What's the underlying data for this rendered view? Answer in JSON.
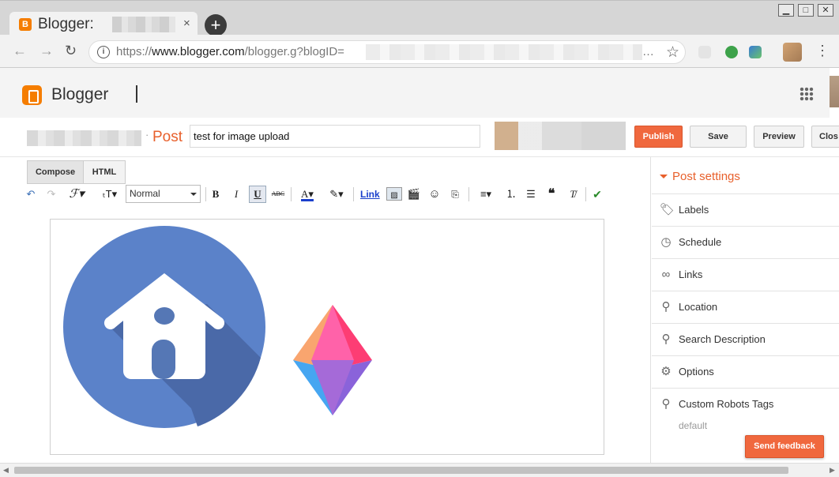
{
  "browser": {
    "tab_title": "Blogger:",
    "tab_close": "×",
    "new_tab": "+",
    "window_controls": [
      "▁",
      "□",
      "✕"
    ],
    "url_prefix": "https://",
    "url_domain": "www.blogger.com",
    "url_path": "/blogger.g?blogID=",
    "url_ellipsis": "…"
  },
  "app": {
    "name": "Blogger",
    "brand_color": "#f57d00"
  },
  "post": {
    "section_label": "Post",
    "title_value": "test for image upload",
    "publish_label": "Publish",
    "save_label": "Save",
    "preview_label": "Preview",
    "close_label": "Clos"
  },
  "editor": {
    "mode_tabs": [
      "Compose",
      "HTML"
    ],
    "active_mode": "Compose",
    "font_size_select": "Normal",
    "link_label": "Link",
    "image_icons": [
      "home-icon-image",
      "diamond-icon-image"
    ]
  },
  "sidebar": {
    "title": "Post settings",
    "items": [
      {
        "label": "Labels",
        "icon": "tag-icon"
      },
      {
        "label": "Schedule",
        "icon": "clock-icon"
      },
      {
        "label": "Links",
        "icon": "link-icon"
      },
      {
        "label": "Location",
        "icon": "pin-icon"
      },
      {
        "label": "Search Description",
        "icon": "search-icon"
      },
      {
        "label": "Options",
        "icon": "gear-icon"
      },
      {
        "label": "Custom Robots Tags",
        "icon": "search-icon"
      }
    ],
    "robots_value": "default"
  },
  "feedback": {
    "label": "Send feedback"
  }
}
